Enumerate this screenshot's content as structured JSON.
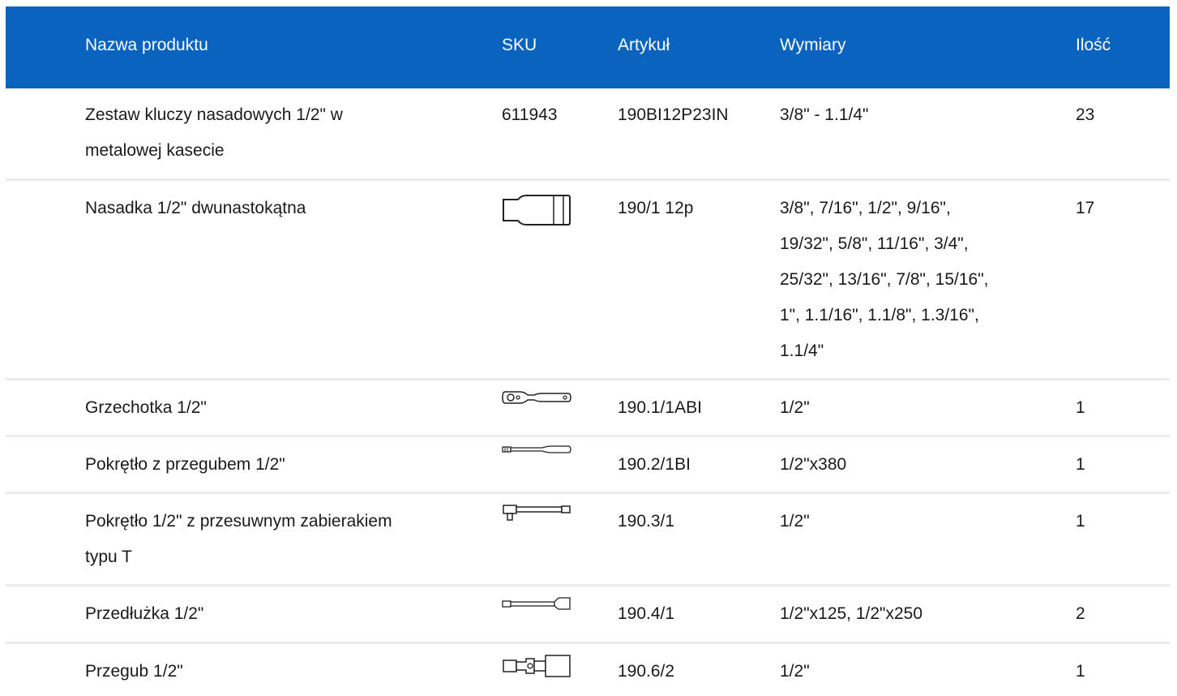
{
  "header": {
    "name": "Nazwa produktu",
    "sku": "SKU",
    "article": "Artykuł",
    "dimensions": "Wymiary",
    "quantity": "Ilość"
  },
  "rows": [
    {
      "name_lines": [
        "Zestaw kluczy nasadowych 1/2\" w",
        "metalowej kasecie"
      ],
      "sku": "611943",
      "sku_icon": null,
      "article": "190BI12P23IN",
      "dimension_lines": [
        "3/8\" - 1.1/4\""
      ],
      "quantity": "23"
    },
    {
      "name_lines": [
        "Nasadka 1/2\" dwunastokątna"
      ],
      "sku": "",
      "sku_icon": "socket-icon",
      "article": "190/1 12p",
      "dimension_lines": [
        "3/8\", 7/16\", 1/2\", 9/16\",",
        "19/32\", 5/8\", 11/16\", 3/4\",",
        "25/32\", 13/16\", 7/8\", 15/16\",",
        "1\", 1.1/16\", 1.1/8\", 1.3/16\",",
        "1.1/4\""
      ],
      "quantity": "17"
    },
    {
      "name_lines": [
        "Grzechotka 1/2\""
      ],
      "sku": "",
      "sku_icon": "ratchet-icon",
      "article": "190.1/1ABI",
      "dimension_lines": [
        "1/2\""
      ],
      "quantity": "1"
    },
    {
      "name_lines": [
        "Pokrętło z przegubem 1/2\""
      ],
      "sku": "",
      "sku_icon": "breaker-bar-icon",
      "article": "190.2/1BI",
      "dimension_lines": [
        "1/2\"x380"
      ],
      "quantity": "1"
    },
    {
      "name_lines": [
        "Pokrętło 1/2\" z przesuwnym zabierakiem",
        "typu T"
      ],
      "sku": "",
      "sku_icon": "t-handle-icon",
      "article": "190.3/1",
      "dimension_lines": [
        "1/2\""
      ],
      "quantity": "1"
    },
    {
      "name_lines": [
        "Przedłużka 1/2\""
      ],
      "sku": "",
      "sku_icon": "extension-bar-icon",
      "article": "190.4/1",
      "dimension_lines": [
        "1/2\"x125, 1/2\"x250"
      ],
      "quantity": "2"
    },
    {
      "name_lines": [
        "Przegub 1/2\""
      ],
      "sku": "",
      "sku_icon": "universal-joint-icon",
      "article": "190.6/2",
      "dimension_lines": [
        "1/2\""
      ],
      "quantity": "1"
    }
  ]
}
